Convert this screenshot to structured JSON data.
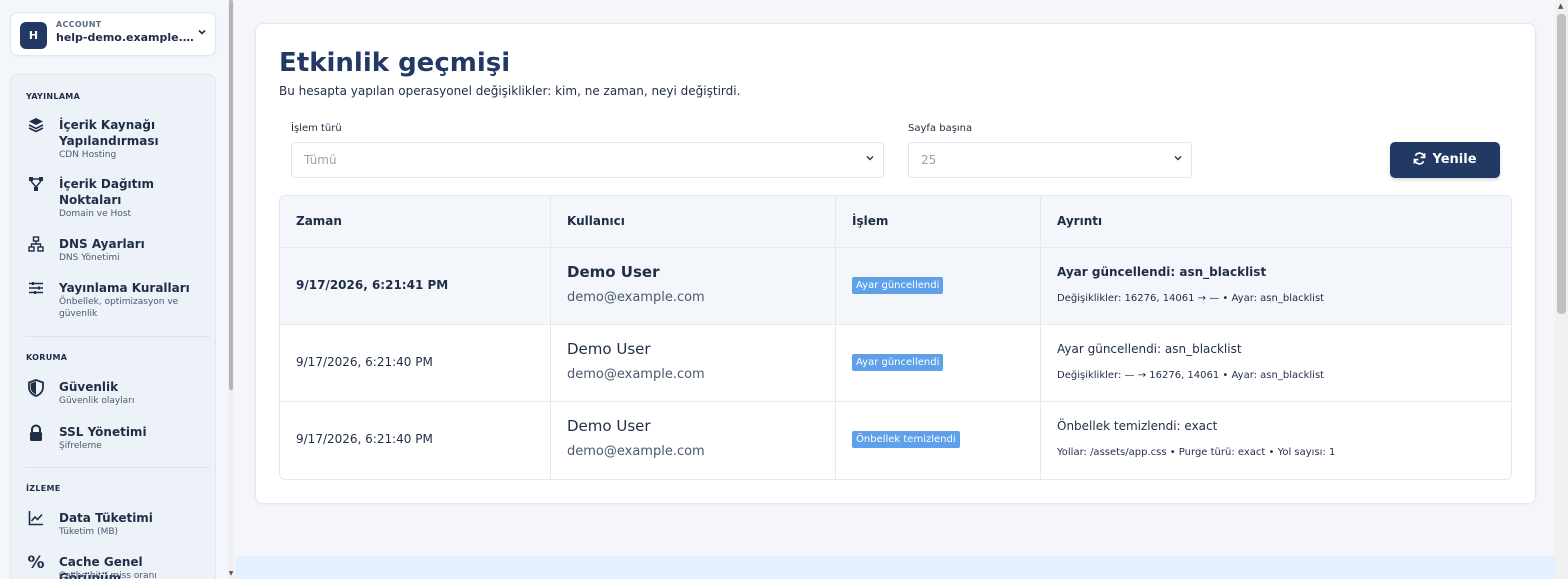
{
  "account": {
    "label": "ACCOUNT",
    "initial": "H",
    "value": "help-demo.example.com"
  },
  "nav": {
    "publishing": {
      "title": "YAYINLAMA",
      "items": [
        {
          "title": "İçerik Kaynağı Yapılandırması",
          "sub": "CDN Hosting",
          "icon": "layers-icon"
        },
        {
          "title": "İçerik Dağıtım Noktaları",
          "sub": "Domain ve Host",
          "icon": "nodes-icon"
        },
        {
          "title": "DNS Ayarları",
          "sub": "DNS Yönetimi",
          "icon": "network-icon"
        },
        {
          "title": "Yayınlama Kuralları",
          "sub": "Önbellek, optimizasyon ve güvenlik",
          "icon": "sliders-icon"
        }
      ]
    },
    "protection": {
      "title": "KORUMA",
      "items": [
        {
          "title": "Güvenlik",
          "sub": "Güvenlik olayları",
          "icon": "shield-icon"
        },
        {
          "title": "SSL Yönetimi",
          "sub": "Şifreleme",
          "icon": "lock-icon"
        }
      ]
    },
    "monitoring": {
      "title": "İZLEME",
      "items": [
        {
          "title": "Data Tüketimi",
          "sub": "Tüketim (MB)",
          "icon": "chart-line-icon"
        },
        {
          "title": "Cache Genel Görünüm",
          "sub": "Cache hit / miss oranı",
          "icon": "percent-icon"
        }
      ]
    }
  },
  "page": {
    "title": "Etkinlik geçmişi",
    "subtitle": "Bu hesapta yapılan operasyonel değişiklikler: kim, ne zaman, neyi değiştirdi."
  },
  "filters": {
    "action_type_label": "İşlem türü",
    "action_type_value": "Tümü",
    "per_page_label": "Sayfa başına",
    "per_page_value": "25",
    "refresh_label": "Yenile"
  },
  "table": {
    "headers": [
      "Zaman",
      "Kullanıcı",
      "İşlem",
      "Ayrıntı"
    ],
    "rows": [
      {
        "time": "9/17/2026, 6:21:41 PM",
        "user_name": "Demo User",
        "user_email": "demo@example.com",
        "action": "Ayar güncellendi",
        "detail_title": "Ayar güncellendi: asn_blacklist",
        "detail_sub": "Değişiklikler: 16276, 14061 → — • Ayar: asn_blacklist"
      },
      {
        "time": "9/17/2026, 6:21:40 PM",
        "user_name": "Demo User",
        "user_email": "demo@example.com",
        "action": "Ayar güncellendi",
        "detail_title": "Ayar güncellendi: asn_blacklist",
        "detail_sub": "Değişiklikler: — → 16276, 14061 • Ayar: asn_blacklist"
      },
      {
        "time": "9/17/2026, 6:21:40 PM",
        "user_name": "Demo User",
        "user_email": "demo@example.com",
        "action": "Önbellek temizlendi",
        "detail_title": "Önbellek temizlendi: exact",
        "detail_sub": "Yollar: /assets/app.css • Purge türü: exact • Yol sayısı: 1"
      }
    ]
  },
  "colors": {
    "primary": "#223a63",
    "badge": "#5ea1ea",
    "sidebar_bg": "#edf2f8"
  }
}
